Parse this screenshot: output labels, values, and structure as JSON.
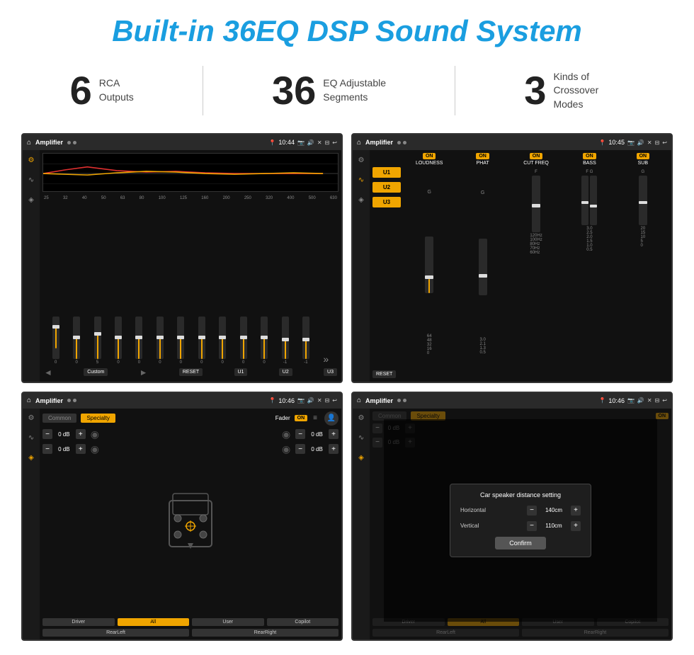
{
  "page": {
    "title": "Built-in 36EQ DSP Sound System",
    "background_color": "#ffffff"
  },
  "stats": [
    {
      "number": "6",
      "label": "RCA\nOutputs"
    },
    {
      "number": "36",
      "label": "EQ Adjustable\nSegments"
    },
    {
      "number": "3",
      "label": "Kinds of\nCrossover Modes"
    }
  ],
  "screenshots": {
    "eq_screen": {
      "title": "Amplifier",
      "time": "10:44",
      "freq_labels": [
        "25",
        "32",
        "40",
        "50",
        "63",
        "80",
        "100",
        "125",
        "160",
        "200",
        "250",
        "320",
        "400",
        "500",
        "630"
      ],
      "eq_values": [
        "0",
        "0",
        "0",
        "5",
        "0",
        "0",
        "0",
        "0",
        "0",
        "0",
        "0",
        "0",
        "-1",
        "-1"
      ],
      "bottom_btns": [
        "Custom",
        "RESET",
        "U1",
        "U2",
        "U3"
      ]
    },
    "crossover_screen": {
      "title": "Amplifier",
      "time": "10:45",
      "presets": [
        "U1",
        "U2",
        "U3"
      ],
      "channels": [
        "LOUDNESS",
        "PHAT",
        "CUT FREQ",
        "BASS",
        "SUB"
      ],
      "on_labels": [
        "ON",
        "ON",
        "ON",
        "ON",
        "ON"
      ],
      "reset_btn": "RESET"
    },
    "fader_screen": {
      "title": "Amplifier",
      "time": "10:46",
      "tabs": [
        "Common",
        "Specialty"
      ],
      "fader_label": "Fader",
      "on_badge": "ON",
      "controls_left": [
        {
          "value": "0 dB"
        },
        {
          "value": "0 dB"
        }
      ],
      "controls_right": [
        {
          "value": "0 dB"
        },
        {
          "value": "0 dB"
        }
      ],
      "zone_btns": [
        "Driver",
        "RearLeft",
        "All",
        "User",
        "Copilot",
        "RearRight"
      ]
    },
    "distance_screen": {
      "title": "Amplifier",
      "time": "10:46",
      "dialog": {
        "title": "Car speaker distance setting",
        "horizontal_label": "Horizontal",
        "horizontal_value": "140cm",
        "vertical_label": "Vertical",
        "vertical_value": "110cm",
        "confirm_btn": "Confirm"
      },
      "zone_btns": [
        "Driver",
        "RearLeft",
        "All",
        "User",
        "Copilot",
        "RearRight"
      ]
    }
  },
  "icons": {
    "home": "⌂",
    "settings": "⚙",
    "eq": "≈",
    "wave": "∿",
    "speaker": "◈",
    "arrow_left": "◄",
    "arrow_right": "►",
    "next": "»",
    "pin": "📍",
    "camera": "📷",
    "volume": "🔊",
    "close_x": "✕",
    "minimize": "⊟",
    "back": "↩",
    "minus": "−",
    "plus": "+"
  }
}
